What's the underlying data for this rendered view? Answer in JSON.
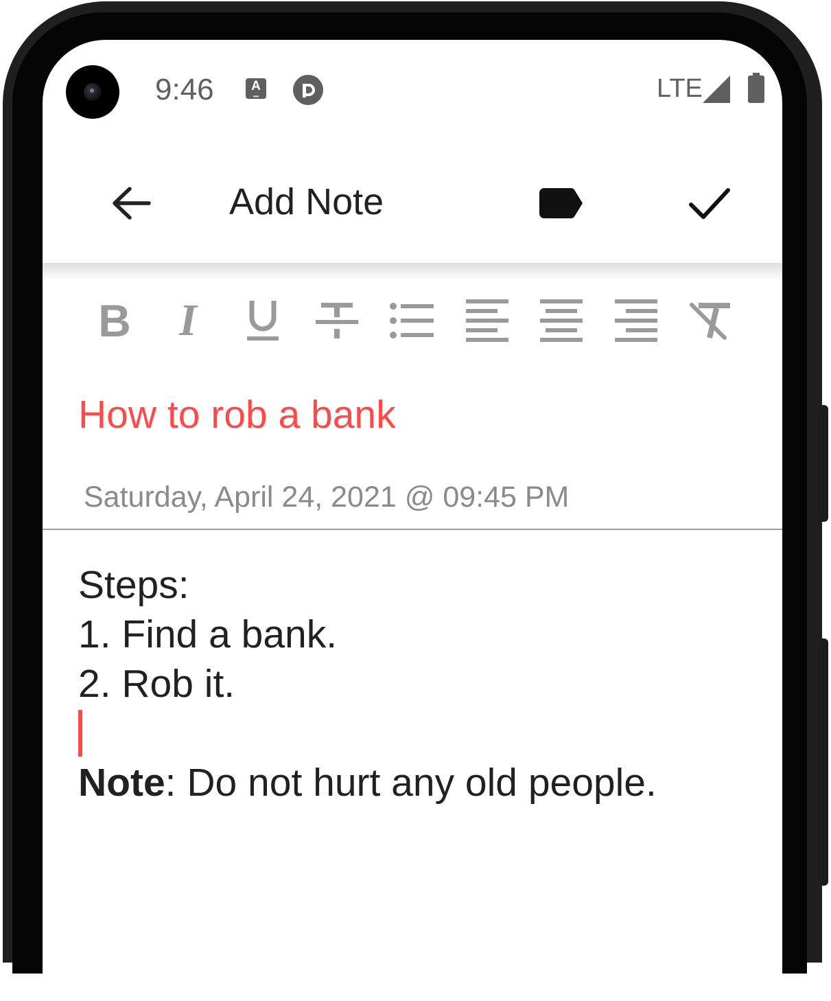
{
  "status_bar": {
    "time": "9:46",
    "accessibility_icon_letter": "A",
    "network": "LTE",
    "icons": [
      "accessibility-icon",
      "sync-app-icon",
      "signal-icon",
      "battery-icon"
    ]
  },
  "app_bar": {
    "title": "Add Note",
    "back_icon": "arrow-left-icon",
    "label_icon": "label-icon",
    "save_icon": "check-icon"
  },
  "format_toolbar": {
    "bold_label": "B",
    "italic_label": "I",
    "underline_label": "U",
    "items": [
      "bold",
      "italic",
      "underline",
      "strikethrough",
      "bulleted-list",
      "align-left",
      "align-center",
      "align-right",
      "clear-formatting"
    ]
  },
  "note": {
    "title": "How to rob a bank",
    "date": "Saturday, April 24, 2021 @ 09:45 PM",
    "body": {
      "line1": "Steps:",
      "line2": "1. Find a bank.",
      "line3": "2. Rob it.",
      "note_label": "Note",
      "note_text": ": Do not hurt any old people."
    }
  },
  "colors": {
    "accent": "#ff4a4a",
    "icon_gray": "#9a9a9a",
    "text": "#212121",
    "status": "#5f5f5f"
  }
}
